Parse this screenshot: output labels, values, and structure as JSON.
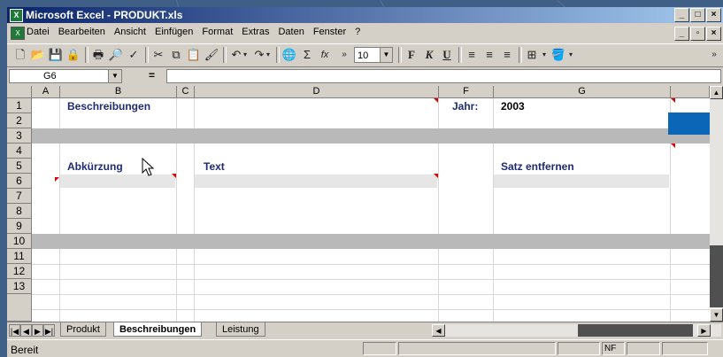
{
  "window": {
    "title": "Microsoft Excel - PRODUKT.xls",
    "minimize": "_",
    "maximize": "□",
    "close": "×"
  },
  "menu": {
    "items": [
      "Datei",
      "Bearbeiten",
      "Ansicht",
      "Einfügen",
      "Format",
      "Extras",
      "Daten",
      "Fenster",
      "?"
    ],
    "doc_minimize": "_",
    "doc_restore": "▫",
    "doc_close": "×"
  },
  "toolbar": {
    "font_size": "10",
    "bold": "F",
    "italic": "K",
    "underline": "U",
    "autosum": "Σ",
    "function": "fx",
    "zoom_icon": "🔍"
  },
  "formula_bar": {
    "cell_ref": "G6",
    "equals": "=",
    "content": ""
  },
  "columns": [
    "A",
    "B",
    "C",
    "D",
    "F",
    "G"
  ],
  "rows": [
    "1",
    "2",
    "3",
    "4",
    "5",
    "6",
    "7",
    "8",
    "9",
    "10",
    "11",
    "12",
    "13"
  ],
  "cells": {
    "b1": "Beschreibungen",
    "f1": "Jahr:",
    "g1": "2003",
    "b5": "Abkürzung",
    "d5": "Text",
    "g5": "Satz entfernen"
  },
  "sheets": {
    "tabs": [
      "Produkt",
      "Beschreibungen",
      "Leistung"
    ],
    "active": "Beschreibungen"
  },
  "status": {
    "text": "Bereit",
    "nf": "NF"
  }
}
